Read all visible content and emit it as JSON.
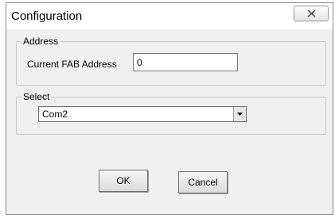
{
  "window": {
    "title": "Configuration",
    "close_icon": "close-x-icon"
  },
  "address_group": {
    "legend": "Address",
    "field_label": "Current FAB Address",
    "field_value": "0"
  },
  "select_group": {
    "legend": "Select",
    "selected_value": "Com2",
    "arrow_icon": "dropdown-arrow-icon"
  },
  "buttons": {
    "ok_label": "OK",
    "cancel_label": "Cancel"
  }
}
